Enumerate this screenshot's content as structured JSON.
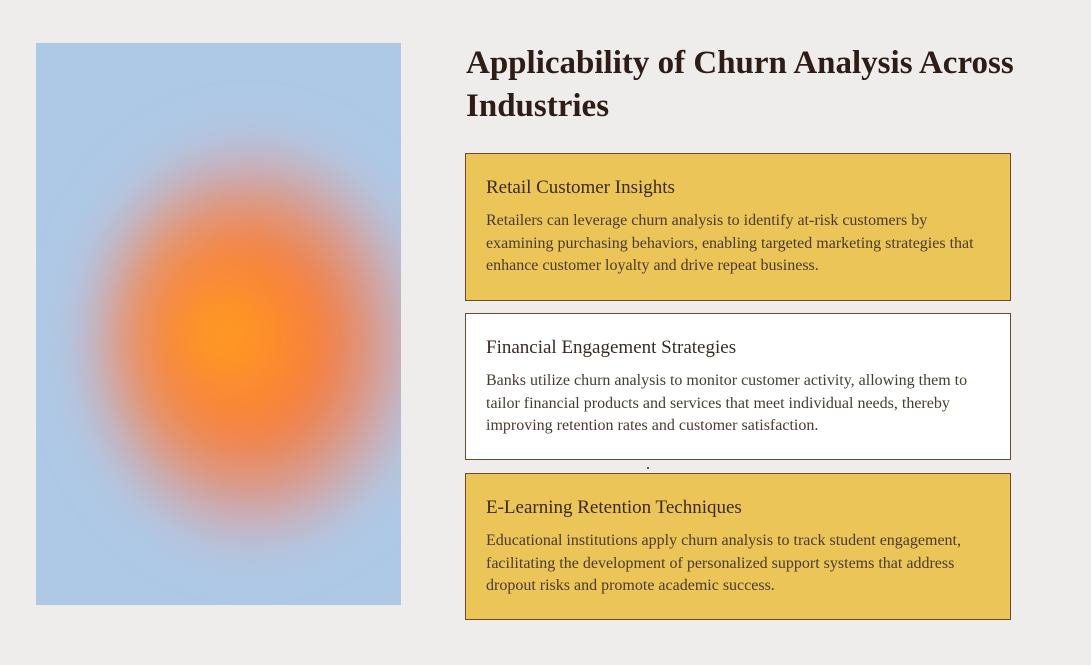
{
  "title": "Applicability of Churn Analysis Across Industries",
  "image": {
    "description_icon": "gradient-blob-image",
    "colors": {
      "background": "#aec9e6",
      "core": "#ff8a1f",
      "mid": "#f2734a",
      "edge": "#d995a0"
    }
  },
  "cards": [
    {
      "heading": "Retail Customer Insights",
      "body": "Retailers can leverage churn analysis to identify at-risk customers by examining purchasing behaviors, enabling targeted marketing strategies that enhance customer loyalty and drive repeat business.",
      "background": "#ebc558"
    },
    {
      "heading": "Financial Engagement Strategies",
      "body": "Banks utilize churn analysis to monitor customer activity, allowing them to tailor financial products and services that meet individual needs, thereby improving retention rates and customer satisfaction.",
      "background": "#ffffff"
    },
    {
      "heading": "E-Learning Retention Techniques",
      "body": "Educational institutions apply churn analysis to track student engagement, facilitating the development of personalized support systems that address dropout risks and promote academic success.",
      "background": "#ebc558"
    }
  ],
  "colors": {
    "page_background": "#efedeb",
    "accent": "#ebc558",
    "border": "#6b4a32",
    "title_text": "#2e1d16"
  }
}
